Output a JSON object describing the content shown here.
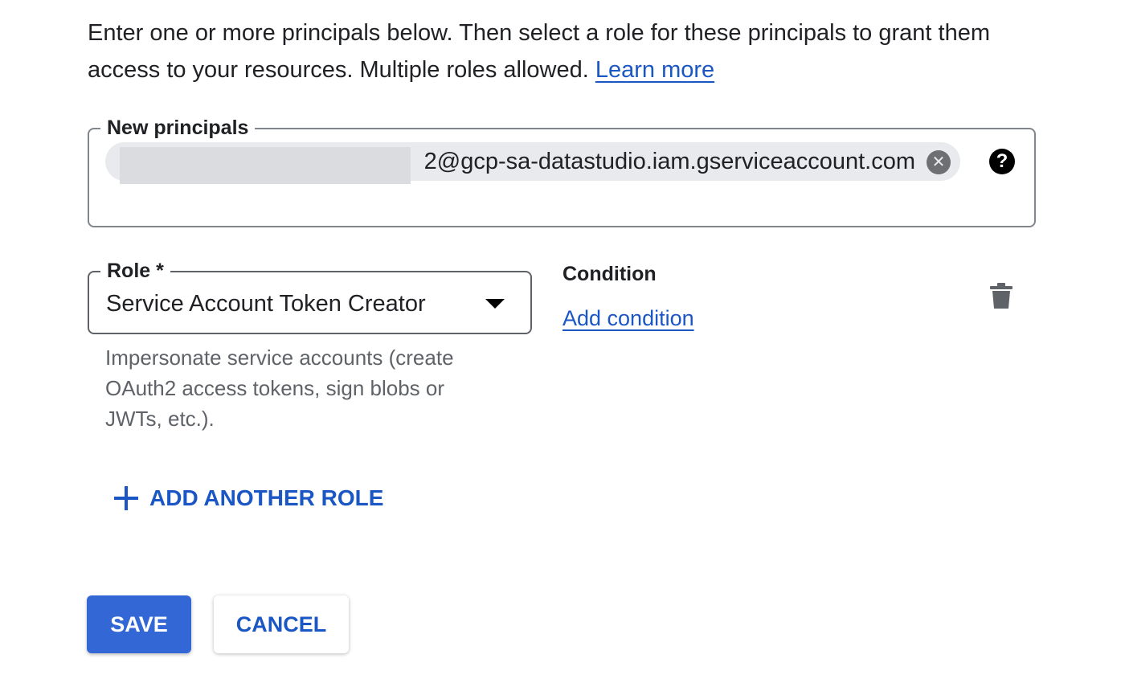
{
  "intro": {
    "text": "Enter one or more principals below. Then select a role for these principals to grant them access to your resources. Multiple roles allowed.",
    "learn_more": "Learn more"
  },
  "principals": {
    "label": "New principals",
    "chip_value": "2@gcp-sa-datastudio.iam.gserviceaccount.com",
    "help_icon": "help-icon"
  },
  "role": {
    "label": "Role *",
    "selected": "Service Account Token Creator",
    "description": "Impersonate service accounts (create OAuth2 access tokens, sign blobs or JWTs, etc.)."
  },
  "condition": {
    "title": "Condition",
    "add_label": "Add condition"
  },
  "add_role_label": "ADD ANOTHER ROLE",
  "actions": {
    "save": "SAVE",
    "cancel": "CANCEL"
  },
  "colors": {
    "accent": "#1a56c4",
    "primary_button": "#3367d6"
  }
}
